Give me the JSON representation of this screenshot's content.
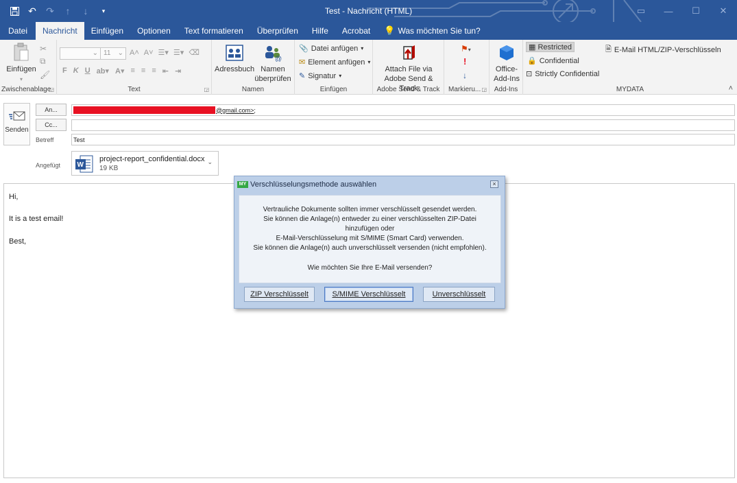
{
  "window": {
    "title": "Test  -  Nachricht (HTML)"
  },
  "tabs": [
    "Datei",
    "Nachricht",
    "Einfügen",
    "Optionen",
    "Text formatieren",
    "Überprüfen",
    "Hilfe",
    "Acrobat"
  ],
  "active_tab": "Nachricht",
  "tell_me": "Was möchten Sie tun?",
  "ribbon": {
    "clipboard": {
      "paste_label": "Einfügen",
      "group_label": "Zwischenablage"
    },
    "text": {
      "font_size": "11",
      "bold": "F",
      "italic": "K",
      "underline": "U",
      "group_label": "Text"
    },
    "names": {
      "address_book": "Adressbuch",
      "check_names_1": "Namen",
      "check_names_2": "überprüfen",
      "group_label": "Namen"
    },
    "include": {
      "attach_file": "Datei anfügen",
      "attach_item": "Element anfügen",
      "signature": "Signatur",
      "group_label": "Einfügen"
    },
    "adobe": {
      "line1": "Attach File via",
      "line2": "Adobe Send & Track",
      "group_label": "Adobe Send & Track"
    },
    "tags": {
      "group_label": "Markieru..."
    },
    "addins": {
      "line1": "Office-",
      "line2": "Add-Ins",
      "group_label": "Add-Ins"
    },
    "mydata": {
      "restricted": "Restricted",
      "confidential": "Confidential",
      "strictly_confidential": "Strictly Confidential",
      "encrypt": "E-Mail HTML/ZIP-Verschlüsseln",
      "group_label": "MYDATA"
    }
  },
  "compose": {
    "send_label": "Senden",
    "to_button": "An...",
    "cc_button": "Cc...",
    "subject_label": "Betreff",
    "to_value": "@gmail.com>;",
    "cc_value": "",
    "subject_value": "Test",
    "attached_label": "Angefügt",
    "attachment": {
      "name": "project-report_confidential.docx",
      "size": "19 KB"
    },
    "body_lines": [
      "Hi,",
      "It is a test email!",
      "Best,"
    ]
  },
  "dialog": {
    "logo": "MY",
    "title": "Verschlüsselungsmethode auswählen",
    "close": "☒",
    "lines": [
      "Vertrauliche Dokumente sollten immer verschlüsselt gesendet werden.",
      "Sie können die Anlage(n) entweder zu einer verschlüsselten ZIP-Datei",
      "hinzufügen oder",
      "E-Mail-Verschlüsselung mit S/MIME (Smart Card) verwenden.",
      "Sie können die Anlage(n) auch unverschlüsselt versenden (nicht empfohlen).",
      "Wie möchten Sie Ihre E-Mail versenden?"
    ],
    "buttons": {
      "zip": "ZIP Verschlüsselt",
      "smime": "S/MIME Verschlüsselt",
      "unencrypted": "Unverschlüsselt"
    }
  },
  "colors": {
    "brand_blue": "#2b579a",
    "redaction": "#e81123",
    "dialog_bg": "#bccfe8"
  },
  "icons": [
    "save-icon",
    "undo-icon",
    "redo-icon",
    "up-icon",
    "down-icon",
    "customize-icon",
    "paste-icon",
    "address-book-icon",
    "check-names-icon",
    "paperclip-icon",
    "flag-icon",
    "importance-high-icon",
    "importance-low-icon",
    "office-addins-icon",
    "lock-icon",
    "word-doc-icon"
  ]
}
